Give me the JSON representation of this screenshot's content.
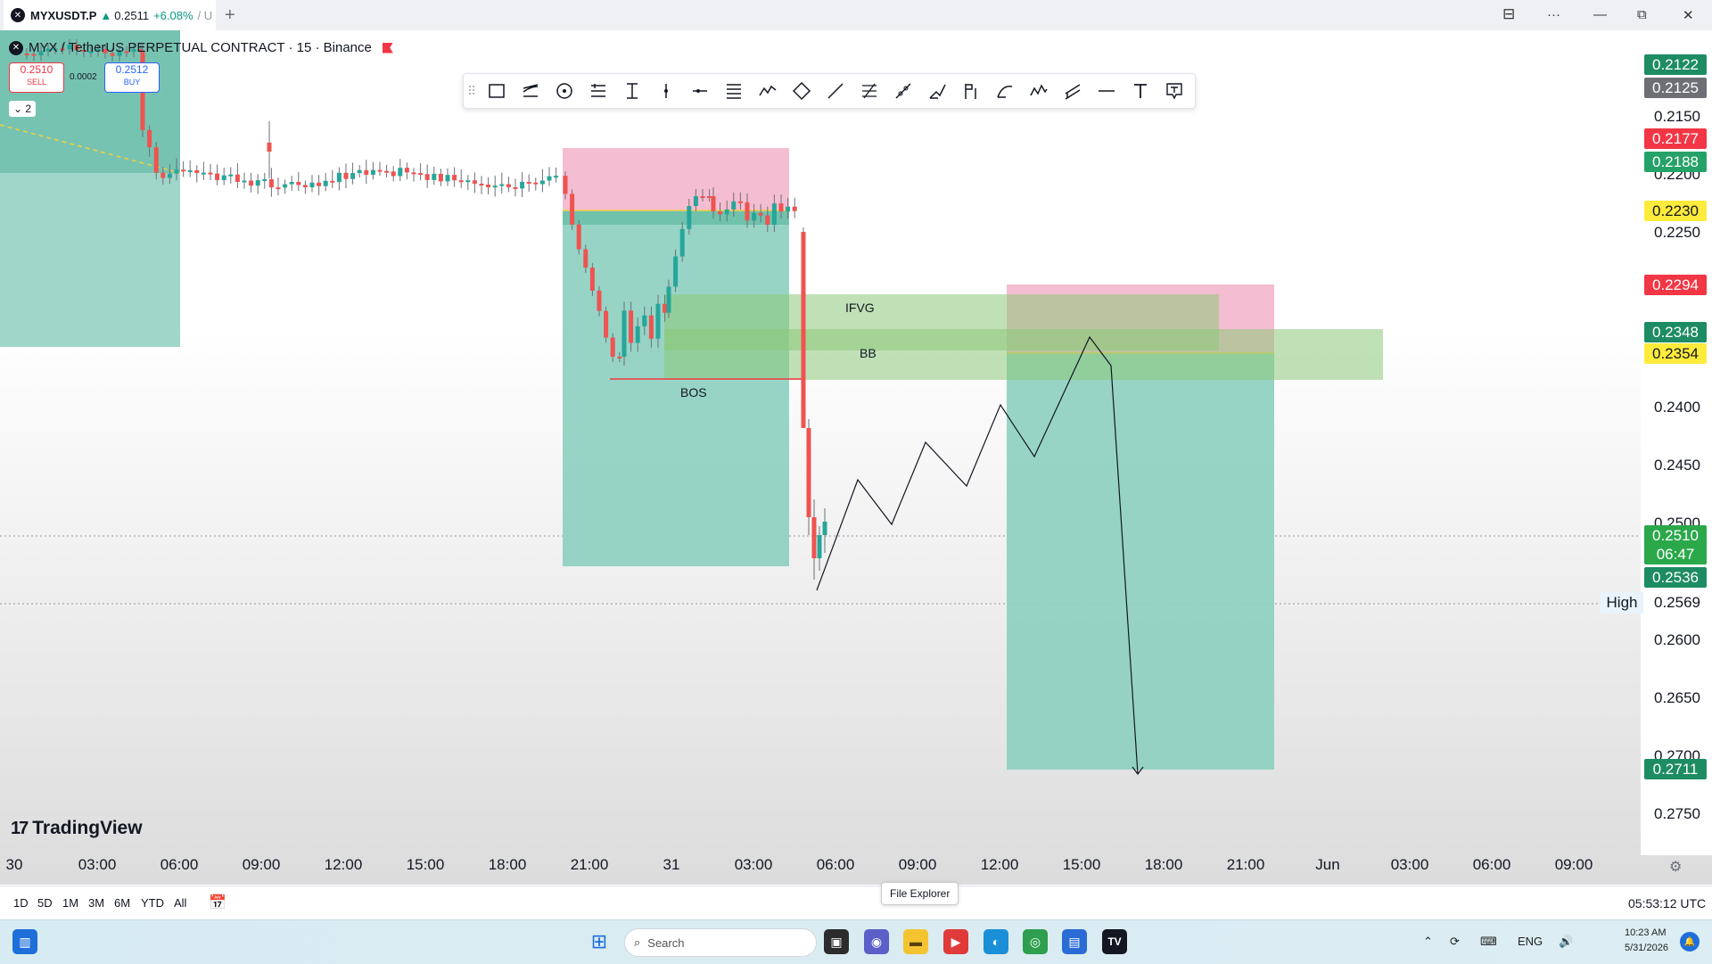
{
  "tab": {
    "symbol": "MYXUSDT.P",
    "arrow": "▲",
    "price": "0.2511",
    "change": "+6.08%",
    "rest": "/ U"
  },
  "new_tab": "+",
  "window": {
    "layout_icon": "⊟",
    "more": "···",
    "minimize": "—",
    "maximize": "⧉",
    "close": "✕"
  },
  "header": {
    "symbol_line": "MYX / TetherUS PERPETUAL CONTRACT · 15 · Binance"
  },
  "trade": {
    "sell_price": "0.2510",
    "sell_label": "SELL",
    "spread": "0.0002",
    "buy_price": "0.2512",
    "buy_label": "BUY",
    "collapse": "⌄ 2"
  },
  "annotations": {
    "ifvg": "IFVG",
    "bb": "BB",
    "bos": "BOS"
  },
  "price_scale": {
    "labels": [
      "0.2150",
      "0.2200",
      "0.2250",
      "0.2400",
      "0.2450",
      "0.2500",
      "0.2600",
      "0.2650",
      "0.2700",
      "0.2750"
    ],
    "badges": [
      {
        "text": "0.2122",
        "color": "#1e8c63"
      },
      {
        "text": "0.2125",
        "color": "#6d6f74"
      },
      {
        "text": "0.2177",
        "color": "#f23645"
      },
      {
        "text": "0.2188",
        "color": "#26a269"
      },
      {
        "text": "0.2230",
        "color": "#ffeb3b"
      },
      {
        "text": "0.2294",
        "color": "#f23645"
      },
      {
        "text": "0.2348",
        "color": "#1e8c63"
      },
      {
        "text": "0.2354",
        "color": "#ffeb3b"
      },
      {
        "text": "0.2510",
        "color": "#2ba84a"
      },
      {
        "text": "06:47",
        "color": "#2ba84a"
      },
      {
        "text": "0.2536",
        "color": "#1e8c63"
      },
      {
        "text": "0.2711",
        "color": "#1e8c63"
      }
    ],
    "high_label": "High",
    "high_value": "0.2569"
  },
  "time_axis": [
    "30",
    "03:00",
    "06:00",
    "09:00",
    "12:00",
    "15:00",
    "18:00",
    "21:00",
    "31",
    "03:00",
    "06:00",
    "09:00",
    "12:00",
    "15:00",
    "18:00",
    "21:00",
    "Jun",
    "03:00",
    "06:00",
    "09:00"
  ],
  "logo": {
    "text": "TradingView",
    "mark": "17"
  },
  "ranges": [
    "1D",
    "5D",
    "1M",
    "3M",
    "6M",
    "YTD",
    "All"
  ],
  "clock": "05:53:12 UTC",
  "tooltip": "File Explorer",
  "taskbar": {
    "search_placeholder": "Search",
    "lang": "ENG",
    "date": "5/31/2026",
    "time": "10:23 AM"
  }
}
